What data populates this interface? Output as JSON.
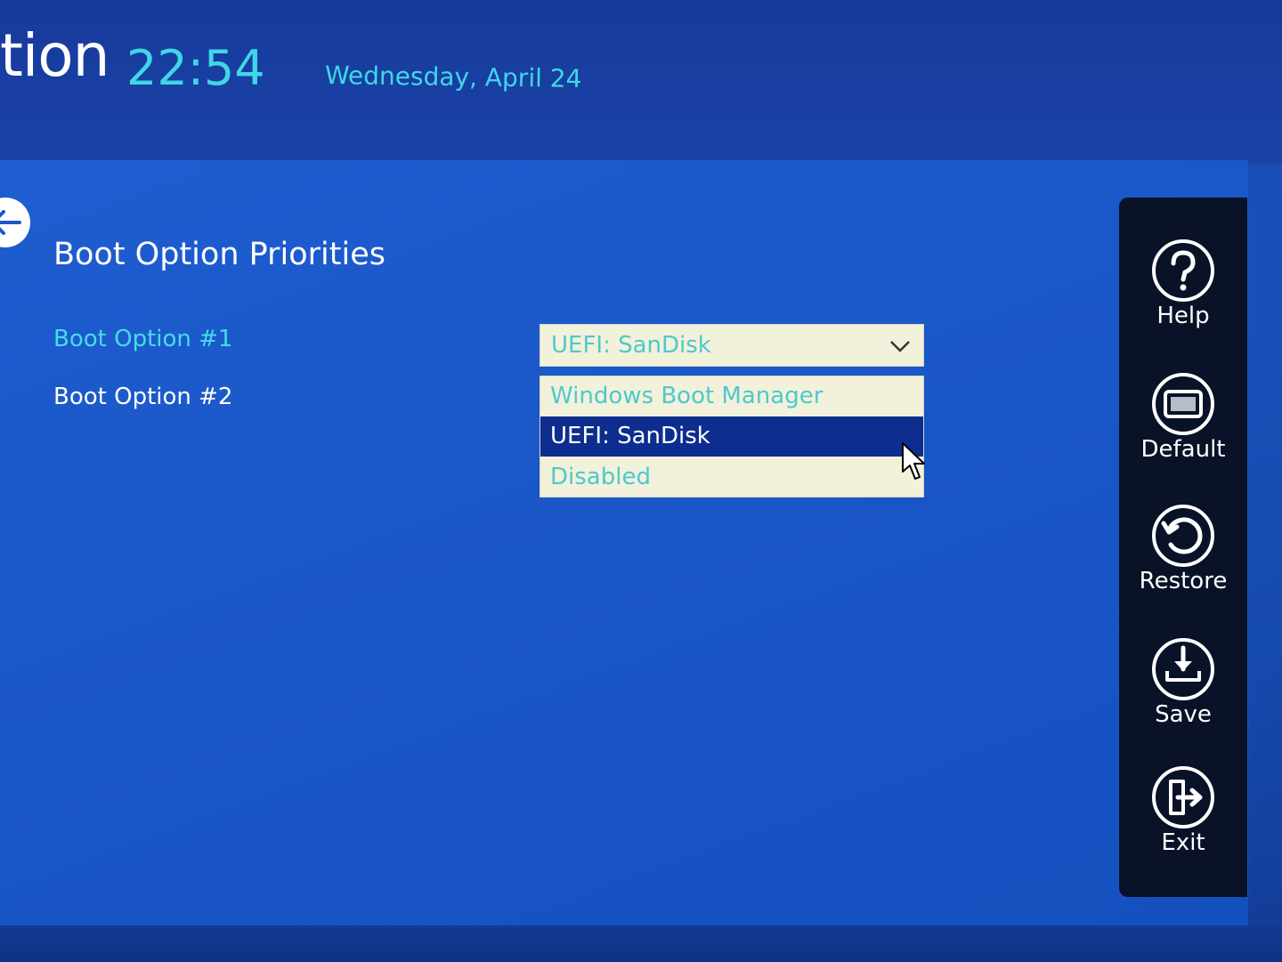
{
  "header": {
    "title_fragment": "tion",
    "time": "22:54",
    "date": "Wednesday, April 24"
  },
  "page": {
    "title": "Boot Option Priorities",
    "back_icon": "arrow-left-icon"
  },
  "boot_options": [
    {
      "label": "Boot Option #1"
    },
    {
      "label": "Boot Option #2"
    }
  ],
  "select": {
    "value": "UEFI: SanDisk",
    "options": [
      "Windows Boot Manager",
      "UEFI: SanDisk",
      "Disabled"
    ],
    "highlighted": "UEFI: SanDisk"
  },
  "toolbar": {
    "help": {
      "label": "Help",
      "icon": "question-circle-icon"
    },
    "default": {
      "label": "Default",
      "icon": "default-monitor-icon"
    },
    "restore": {
      "label": "Restore",
      "icon": "restore-icon"
    },
    "save": {
      "label": "Save",
      "icon": "download-icon"
    },
    "exit": {
      "label": "Exit",
      "icon": "exit-door-icon"
    }
  },
  "colors": {
    "accent": "#3fd7e6",
    "background": "#1a57c8",
    "highlight": "#0d2d8f",
    "dropdown_bg": "#f1f1dc",
    "toolbar_bg": "#091226"
  }
}
